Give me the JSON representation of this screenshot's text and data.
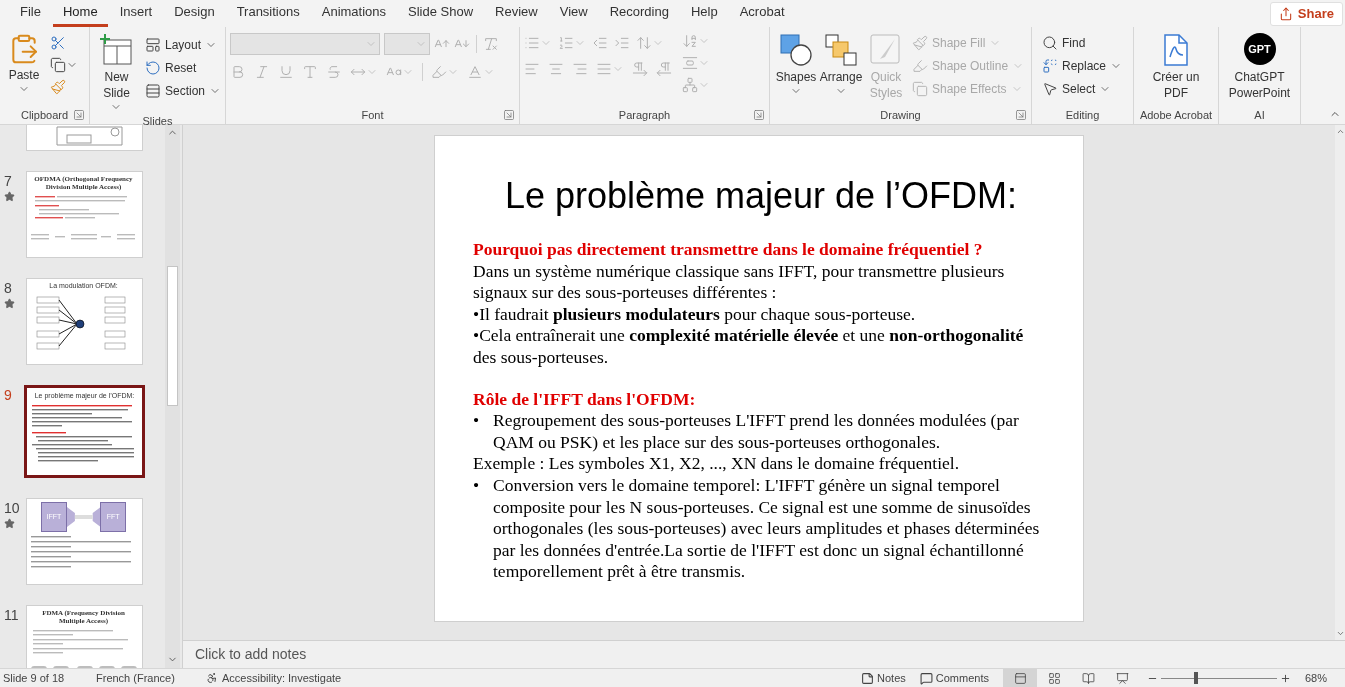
{
  "ribbon_tabs": [
    {
      "label": "File",
      "selected": false
    },
    {
      "label": "Home",
      "selected": true
    },
    {
      "label": "Insert",
      "selected": false
    },
    {
      "label": "Design",
      "selected": false
    },
    {
      "label": "Transitions",
      "selected": false
    },
    {
      "label": "Animations",
      "selected": false
    },
    {
      "label": "Slide Show",
      "selected": false
    },
    {
      "label": "Review",
      "selected": false
    },
    {
      "label": "View",
      "selected": false
    },
    {
      "label": "Recording",
      "selected": false
    },
    {
      "label": "Help",
      "selected": false
    },
    {
      "label": "Acrobat",
      "selected": false
    }
  ],
  "share": {
    "label": "Share"
  },
  "ribbon": {
    "groups": [
      {
        "kind": "clipboard",
        "label": "Clipboard",
        "items": [
          {
            "label": "Paste"
          }
        ]
      },
      {
        "kind": "slides",
        "label": "Slides",
        "items": [
          {
            "label": "New Slide"
          },
          {
            "label": "Layout"
          },
          {
            "label": "Reset"
          },
          {
            "label": "Section"
          }
        ]
      },
      {
        "kind": "font",
        "label": "Font",
        "disabled": true
      },
      {
        "kind": "paragraph",
        "label": "Paragraph",
        "disabled": true
      },
      {
        "kind": "drawing",
        "label": "Drawing",
        "items": [
          {
            "label": "Shapes",
            "disabled": false
          },
          {
            "label": "Arrange",
            "disabled": false
          },
          {
            "label": "Quick Styles",
            "disabled": true
          },
          {
            "label": "Shape Fill",
            "disabled": true
          },
          {
            "label": "Shape Outline",
            "disabled": true
          },
          {
            "label": "Shape Effects",
            "disabled": true
          }
        ]
      },
      {
        "kind": "editing",
        "label": "Editing",
        "items": [
          {
            "label": "Find"
          },
          {
            "label": "Replace"
          },
          {
            "label": "Select"
          }
        ]
      },
      {
        "kind": "acrobat",
        "label": "Adobe Acrobat",
        "items": [
          {
            "label": "Créer un PDF"
          }
        ]
      },
      {
        "kind": "ai",
        "label": "AI",
        "logo_text": "GPT",
        "items": [
          {
            "label": "ChatGPT PowerPoint"
          }
        ]
      }
    ]
  },
  "slides": [
    {
      "kind": "diagram",
      "partial": true,
      "transition": false,
      "selected": false
    },
    {
      "kind": "text_diagram",
      "number": "7",
      "title": "OFDMA (Orthogonal Frequency Division Multiple Access)",
      "transition": true,
      "selected": false
    },
    {
      "kind": "modulation",
      "number": "8",
      "title": "La modulation OFDM:",
      "transition": true,
      "selected": false
    },
    {
      "kind": "text",
      "number": "9",
      "title": "Le problème majeur de l’OFDM:",
      "transition": false,
      "selected": true
    },
    {
      "kind": "ifft",
      "number": "10",
      "labels": [
        "IFFT",
        "FFT"
      ],
      "transition": true,
      "selected": false
    },
    {
      "kind": "fdma",
      "number": "11",
      "title": "FDMA (Frequency Division Multiple Access)",
      "transition": false,
      "selected": false
    }
  ],
  "slide": {
    "title": "Le problème majeur de l’OFDM:",
    "blocks": [
      {
        "kind": "heading",
        "text": "Pourquoi pas directement transmettre dans le domaine fréquentiel ?"
      },
      {
        "kind": "text",
        "text": "Dans un système numérique classique sans IFFT, pour transmettre plusieurs signaux sur des sous-porteuses différentes :"
      },
      {
        "kind": "text",
        "text": "•Il faudrait **plusieurs modulateurs** pour chaque sous-porteuse."
      },
      {
        "kind": "text",
        "text": "•Cela entraînerait une **complexité matérielle élevée** et une **non-orthogonalité** des sous-porteuses."
      },
      {
        "kind": "heading",
        "text": "Rôle de l'IFFT dans l'OFDM:"
      },
      {
        "kind": "bullet",
        "marker": "•",
        "text": "Regroupement des sous-porteuses L'IFFT prend les données modulées (par QAM ou PSK) et les place sur des sous-porteuses orthogonales."
      },
      {
        "kind": "text",
        "text": "Exemple : Les symboles X1, X2, ..., XN dans le domaine fréquentiel."
      },
      {
        "kind": "bullet",
        "marker": "•",
        "text": "Conversion vers le domaine temporel: L'IFFT génère un signal temporel composite pour les N sous-porteuses. Ce signal est une somme de sinusoïdes orthogonales (les sous-porteuses) avec leurs amplitudes et phases déterminées par les données d'entrée.La sortie de l'IFFT est donc un signal échantillonné temporellement prêt à être transmis."
      }
    ]
  },
  "notes": {
    "placeholder": "Click to add notes"
  },
  "status": {
    "slide_info": "Slide 9 of 18",
    "language": "French (France)",
    "accessibility": "Accessibility: Investigate",
    "notes_button": "Notes",
    "comments_button": "Comments",
    "views": [
      {
        "selected": true
      },
      {
        "selected": false
      },
      {
        "selected": false
      },
      {
        "selected": false
      }
    ],
    "zoom": {
      "level": 0.3,
      "reading": "68%"
    }
  }
}
